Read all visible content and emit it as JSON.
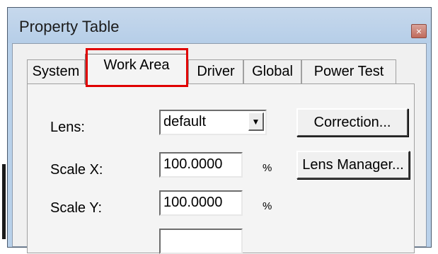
{
  "window": {
    "title": "Property Table",
    "close_glyph": "×"
  },
  "tabs": [
    {
      "label": "System",
      "selected": false
    },
    {
      "label": "Work Area",
      "selected": true
    },
    {
      "label": "Driver",
      "selected": false
    },
    {
      "label": "Global",
      "selected": false
    },
    {
      "label": "Power Test",
      "selected": false
    }
  ],
  "form": {
    "lens": {
      "label": "Lens:",
      "value": "default",
      "arrow_glyph": "▼"
    },
    "correction_button": "Correction...",
    "scale_x": {
      "label": "Scale X:",
      "value": "100.0000",
      "unit": "%"
    },
    "lens_manager_button": "Lens Manager...",
    "scale_y": {
      "label": "Scale Y:",
      "value": "100.0000",
      "unit": "%"
    }
  },
  "colors": {
    "highlight": "#e00000",
    "titlebar": "#b9d1ea",
    "panel": "#f0f0f0"
  }
}
